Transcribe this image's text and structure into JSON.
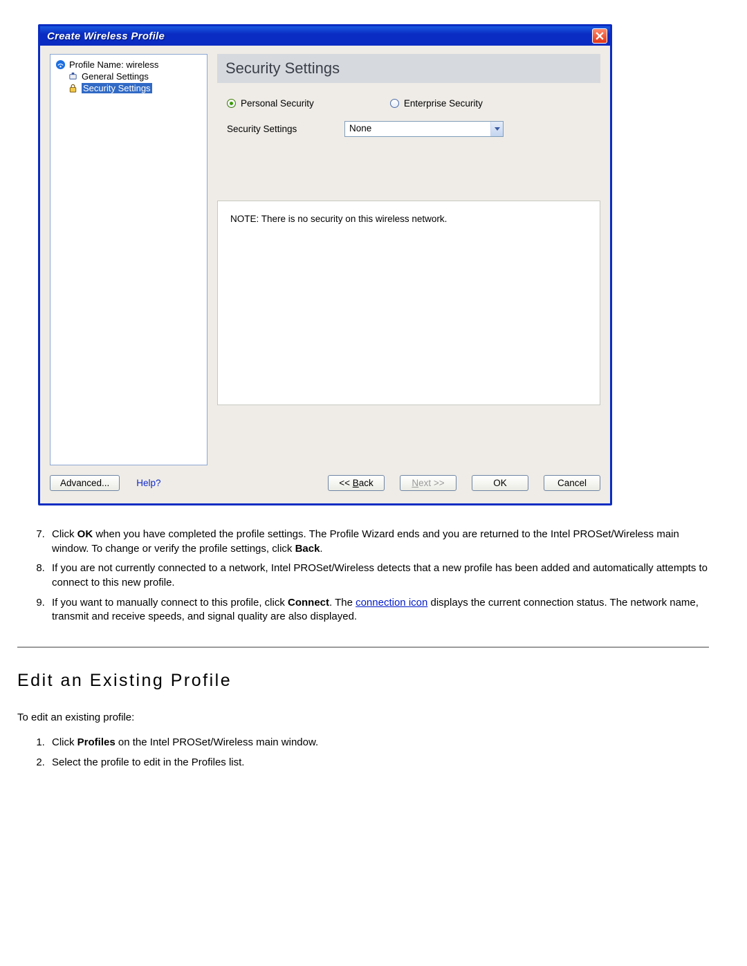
{
  "window": {
    "title": "Create Wireless Profile",
    "tree": {
      "items": [
        {
          "label": "Profile Name: wireless",
          "icon": "wifi-icon",
          "indent": 0
        },
        {
          "label": "General Settings",
          "icon": "device-icon",
          "indent": 18
        },
        {
          "label": "Security Settings",
          "icon": "lock-icon",
          "indent": 18,
          "selected": true
        }
      ]
    },
    "section_title": "Security Settings",
    "radio_personal": "Personal Security",
    "radio_enterprise": "Enterprise Security",
    "sec_label": "Security Settings",
    "sec_select_value": "None",
    "note_text": "NOTE: There is no security on this wireless network.",
    "buttons": {
      "advanced": "Advanced...",
      "help": "Help?",
      "back": "<< Back",
      "next": "Next >>",
      "ok": "OK",
      "cancel": "Cancel"
    }
  },
  "doc": {
    "list1": {
      "start": 7,
      "items": [
        {
          "pre": "Click ",
          "b1": "OK",
          "mid": " when you have completed the profile settings. The Profile Wizard ends and you are returned to the Intel PROSet/Wireless main window. To change or verify the profile settings, click ",
          "b2": "Back",
          "post": "."
        },
        {
          "text": "If you are not currently connected to a network, Intel PROSet/Wireless detects that a new profile has been added and automatically attempts to connect to this new profile."
        },
        {
          "pre": "If you want to manually connect to this profile, click ",
          "b1": "Connect",
          "mid": ". The ",
          "link": "connection icon",
          "post": " displays the current connection status. The network name, transmit and receive speeds, and signal quality are also displayed."
        }
      ]
    },
    "h2": "Edit an Existing Profile",
    "lead": "To edit an existing profile:",
    "list2": {
      "items": [
        {
          "pre": "Click ",
          "b1": "Profiles",
          "post": " on the Intel PROSet/Wireless main window."
        },
        {
          "text": "Select the profile to edit in the Profiles list."
        }
      ]
    }
  }
}
